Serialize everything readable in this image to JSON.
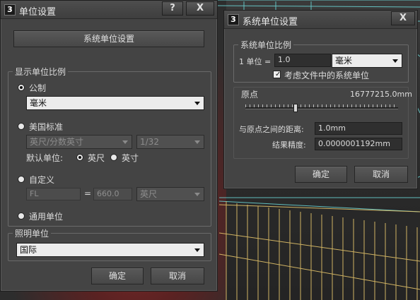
{
  "left_dialog": {
    "icon_glyph": "3",
    "title": "单位设置",
    "help_glyph": "?",
    "close_glyph": "X",
    "system_units_button": "系统单位设置",
    "display_scale": {
      "title": "显示单位比例",
      "metric_label": "公制",
      "metric_value": "毫米",
      "us_label": "美国标准",
      "us_value": "英尺/分数英寸",
      "us_fraction": "1/32",
      "default_unit_label": "默认单位:",
      "feet_label": "英尺",
      "inches_label": "英寸",
      "custom_label": "自定义",
      "custom_name": "FL",
      "equals": "=",
      "custom_value": "660.0",
      "custom_unit": "英尺",
      "generic_label": "通用单位"
    },
    "lighting": {
      "title": "照明单位",
      "value": "国际"
    },
    "ok_label": "确定",
    "cancel_label": "取消"
  },
  "right_dialog": {
    "icon_glyph": "3",
    "title": "系统单位设置",
    "close_glyph": "X",
    "scale": {
      "title": "系统单位比例",
      "unit_label": "1 单位 =",
      "unit_value": "1.0",
      "unit_type": "毫米",
      "consider_label": "考虑文件中的系统单位"
    },
    "origin": {
      "label": "原点",
      "value": "16777215.0mm",
      "distance_label": "与原点之间的距离:",
      "distance_value": "1.0mm",
      "precision_label": "结果精度:",
      "precision_value": "0.0000001192mm"
    },
    "ok_label": "确定",
    "cancel_label": "取消"
  },
  "colors": {
    "dialog_bg": "#444444",
    "viewport_lines_yellow": "#e3c36a",
    "viewport_lines_cyan": "#6fe3e3",
    "viewport_red": "#8a2a2a"
  }
}
